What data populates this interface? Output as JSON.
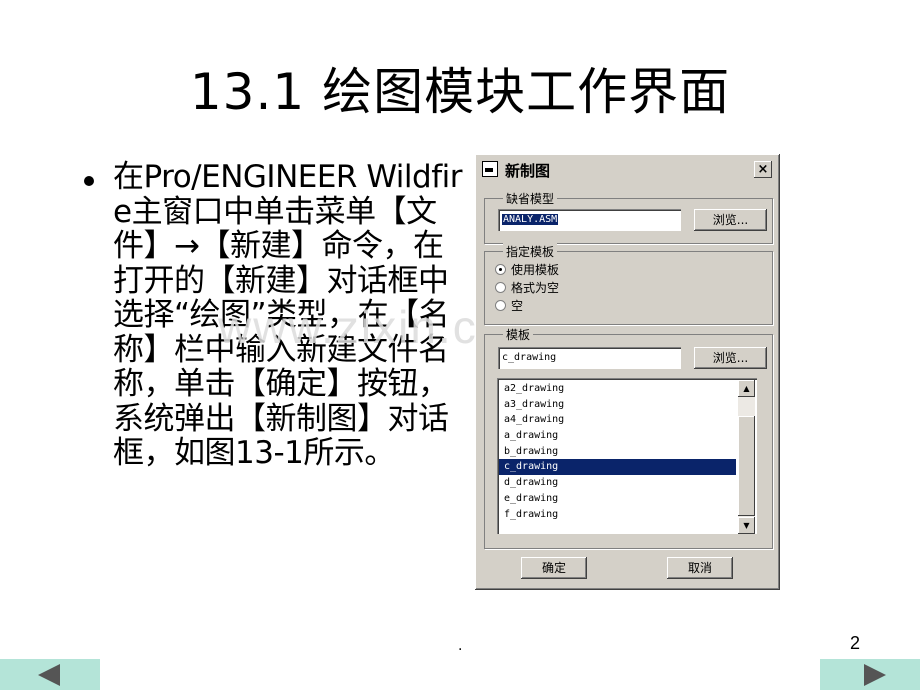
{
  "slide": {
    "title": "13.1  绘图模块工作界面",
    "bullet": "在Pro/ENGINEER Wildfire主窗口中单击菜单【文件】→【新建】命令，在打开的【新建】对话框中选择“绘图”类型，在【名称】栏中输入新建文件名称，单击【确定】按钮，系统弹出【新制图】对话框，如图13-1所示。",
    "watermark": "www.zixin.com.cn",
    "page_number": "2",
    "center_mark": ".",
    "nav": {
      "prev_icon": "triangle-left-icon",
      "next_icon": "triangle-right-icon"
    },
    "colors": {
      "nav_bg": "#b4e4d8",
      "selection": "#0a246a",
      "dialog_bg": "#d4d0c8"
    }
  },
  "dialog": {
    "title": "新制图",
    "close_label": "×",
    "default_model": {
      "group_label": "缺省模型",
      "value": "ANALY.ASM",
      "browse_label": "浏览..."
    },
    "template_spec": {
      "group_label": "指定模板",
      "options": [
        {
          "label": "使用模板",
          "checked": true
        },
        {
          "label": "格式为空",
          "checked": false
        },
        {
          "label": "空",
          "checked": false
        }
      ]
    },
    "template": {
      "group_label": "模板",
      "value": "c_drawing",
      "browse_label": "浏览...",
      "items": [
        "a2_drawing",
        "a3_drawing",
        "a4_drawing",
        "a_drawing",
        "b_drawing",
        "c_drawing",
        "d_drawing",
        "e_drawing",
        "f_drawing"
      ],
      "selected": "c_drawing"
    },
    "ok_label": "确定",
    "cancel_label": "取消"
  }
}
